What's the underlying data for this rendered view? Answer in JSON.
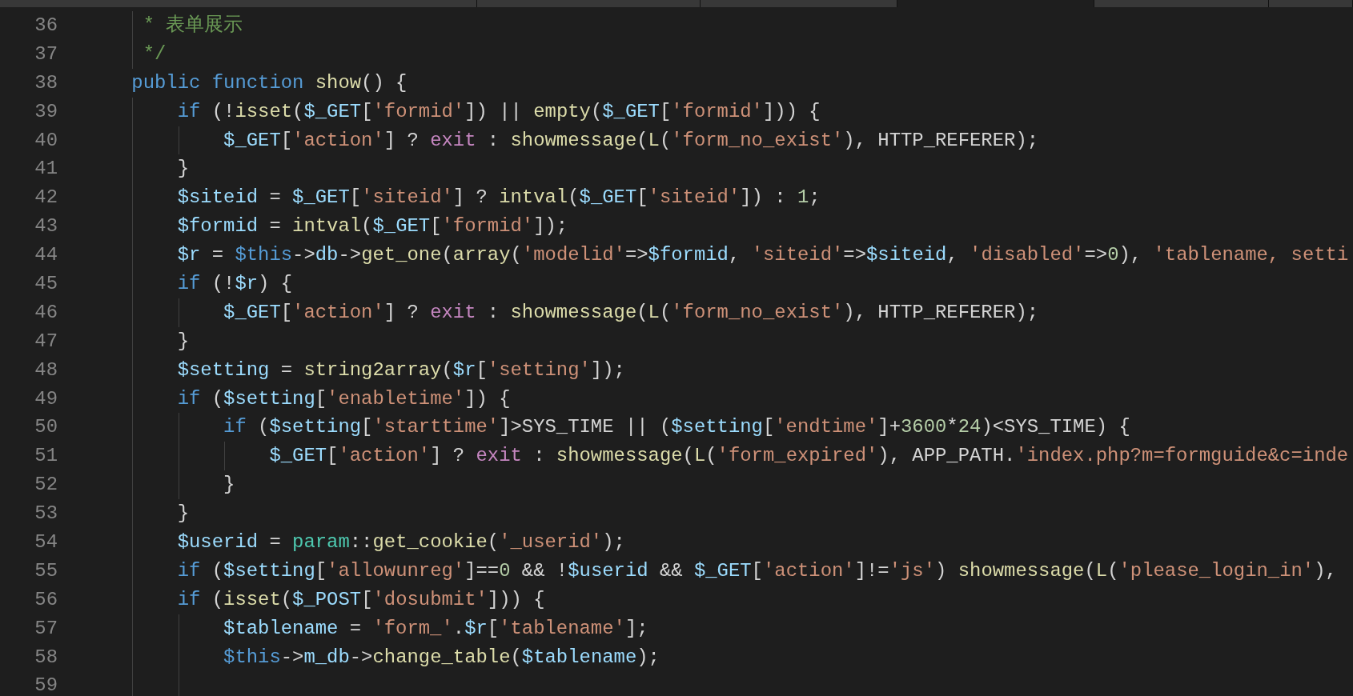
{
  "tabs": [
    {
      "selected": false
    },
    {
      "selected": false
    },
    {
      "selected": false
    },
    {
      "selected": true
    },
    {
      "selected": false
    },
    {
      "selected": false
    }
  ],
  "lines": [
    {
      "number": "36",
      "tokens": [
        {
          "kind": "comment",
          "text": "     * 表单展示"
        }
      ]
    },
    {
      "number": "37",
      "tokens": [
        {
          "kind": "comment",
          "text": "     */"
        }
      ]
    },
    {
      "number": "38",
      "tokens": [
        {
          "kind": "keyword",
          "text": "    public function "
        },
        {
          "kind": "function",
          "text": "show"
        },
        {
          "kind": "plain",
          "text": "() {"
        }
      ]
    },
    {
      "number": "39",
      "tokens": [
        {
          "kind": "keyword",
          "text": "        if "
        },
        {
          "kind": "plain",
          "text": "(!"
        },
        {
          "kind": "function",
          "text": "isset"
        },
        {
          "kind": "plain",
          "text": "("
        },
        {
          "kind": "variable",
          "text": "$_GET"
        },
        {
          "kind": "plain",
          "text": "["
        },
        {
          "kind": "string",
          "text": "'formid'"
        },
        {
          "kind": "plain",
          "text": "]) || "
        },
        {
          "kind": "function",
          "text": "empty"
        },
        {
          "kind": "plain",
          "text": "("
        },
        {
          "kind": "variable",
          "text": "$_GET"
        },
        {
          "kind": "plain",
          "text": "["
        },
        {
          "kind": "string",
          "text": "'formid'"
        },
        {
          "kind": "plain",
          "text": "])) {"
        }
      ]
    },
    {
      "number": "40",
      "tokens": [
        {
          "kind": "variable",
          "text": "            $_GET"
        },
        {
          "kind": "plain",
          "text": "["
        },
        {
          "kind": "string",
          "text": "'action'"
        },
        {
          "kind": "plain",
          "text": "] ? "
        },
        {
          "kind": "control",
          "text": "exit"
        },
        {
          "kind": "plain",
          "text": " : "
        },
        {
          "kind": "function",
          "text": "showmessage"
        },
        {
          "kind": "plain",
          "text": "("
        },
        {
          "kind": "function",
          "text": "L"
        },
        {
          "kind": "plain",
          "text": "("
        },
        {
          "kind": "string",
          "text": "'form_no_exist'"
        },
        {
          "kind": "plain",
          "text": "), HTTP_REFERER);"
        }
      ]
    },
    {
      "number": "41",
      "tokens": [
        {
          "kind": "plain",
          "text": "        }"
        }
      ]
    },
    {
      "number": "42",
      "tokens": [
        {
          "kind": "variable",
          "text": "        $siteid"
        },
        {
          "kind": "plain",
          "text": " = "
        },
        {
          "kind": "variable",
          "text": "$_GET"
        },
        {
          "kind": "plain",
          "text": "["
        },
        {
          "kind": "string",
          "text": "'siteid'"
        },
        {
          "kind": "plain",
          "text": "] ? "
        },
        {
          "kind": "function",
          "text": "intval"
        },
        {
          "kind": "plain",
          "text": "("
        },
        {
          "kind": "variable",
          "text": "$_GET"
        },
        {
          "kind": "plain",
          "text": "["
        },
        {
          "kind": "string",
          "text": "'siteid'"
        },
        {
          "kind": "plain",
          "text": "]) : "
        },
        {
          "kind": "number",
          "text": "1"
        },
        {
          "kind": "plain",
          "text": ";"
        }
      ]
    },
    {
      "number": "43",
      "tokens": [
        {
          "kind": "variable",
          "text": "        $formid"
        },
        {
          "kind": "plain",
          "text": " = "
        },
        {
          "kind": "function",
          "text": "intval"
        },
        {
          "kind": "plain",
          "text": "("
        },
        {
          "kind": "variable",
          "text": "$_GET"
        },
        {
          "kind": "plain",
          "text": "["
        },
        {
          "kind": "string",
          "text": "'formid'"
        },
        {
          "kind": "plain",
          "text": "]);"
        }
      ]
    },
    {
      "number": "44",
      "tokens": [
        {
          "kind": "variable",
          "text": "        $r"
        },
        {
          "kind": "plain",
          "text": " = "
        },
        {
          "kind": "keyword",
          "text": "$this"
        },
        {
          "kind": "plain",
          "text": "->"
        },
        {
          "kind": "variable",
          "text": "db"
        },
        {
          "kind": "plain",
          "text": "->"
        },
        {
          "kind": "function",
          "text": "get_one"
        },
        {
          "kind": "plain",
          "text": "("
        },
        {
          "kind": "function",
          "text": "array"
        },
        {
          "kind": "plain",
          "text": "("
        },
        {
          "kind": "string",
          "text": "'modelid'"
        },
        {
          "kind": "plain",
          "text": "=>"
        },
        {
          "kind": "variable",
          "text": "$formid"
        },
        {
          "kind": "plain",
          "text": ", "
        },
        {
          "kind": "string",
          "text": "'siteid'"
        },
        {
          "kind": "plain",
          "text": "=>"
        },
        {
          "kind": "variable",
          "text": "$siteid"
        },
        {
          "kind": "plain",
          "text": ", "
        },
        {
          "kind": "string",
          "text": "'disabled'"
        },
        {
          "kind": "plain",
          "text": "=>"
        },
        {
          "kind": "number",
          "text": "0"
        },
        {
          "kind": "plain",
          "text": "), "
        },
        {
          "kind": "string",
          "text": "'tablename, setti"
        }
      ]
    },
    {
      "number": "45",
      "tokens": [
        {
          "kind": "keyword",
          "text": "        if "
        },
        {
          "kind": "plain",
          "text": "(!"
        },
        {
          "kind": "variable",
          "text": "$r"
        },
        {
          "kind": "plain",
          "text": ") {"
        }
      ]
    },
    {
      "number": "46",
      "tokens": [
        {
          "kind": "variable",
          "text": "            $_GET"
        },
        {
          "kind": "plain",
          "text": "["
        },
        {
          "kind": "string",
          "text": "'action'"
        },
        {
          "kind": "plain",
          "text": "] ? "
        },
        {
          "kind": "control",
          "text": "exit"
        },
        {
          "kind": "plain",
          "text": " : "
        },
        {
          "kind": "function",
          "text": "showmessage"
        },
        {
          "kind": "plain",
          "text": "("
        },
        {
          "kind": "function",
          "text": "L"
        },
        {
          "kind": "plain",
          "text": "("
        },
        {
          "kind": "string",
          "text": "'form_no_exist'"
        },
        {
          "kind": "plain",
          "text": "), HTTP_REFERER);"
        }
      ]
    },
    {
      "number": "47",
      "tokens": [
        {
          "kind": "plain",
          "text": "        }"
        }
      ]
    },
    {
      "number": "48",
      "tokens": [
        {
          "kind": "variable",
          "text": "        $setting"
        },
        {
          "kind": "plain",
          "text": " = "
        },
        {
          "kind": "function",
          "text": "string2array"
        },
        {
          "kind": "plain",
          "text": "("
        },
        {
          "kind": "variable",
          "text": "$r"
        },
        {
          "kind": "plain",
          "text": "["
        },
        {
          "kind": "string",
          "text": "'setting'"
        },
        {
          "kind": "plain",
          "text": "]);"
        }
      ]
    },
    {
      "number": "49",
      "tokens": [
        {
          "kind": "keyword",
          "text": "        if "
        },
        {
          "kind": "plain",
          "text": "("
        },
        {
          "kind": "variable",
          "text": "$setting"
        },
        {
          "kind": "plain",
          "text": "["
        },
        {
          "kind": "string",
          "text": "'enabletime'"
        },
        {
          "kind": "plain",
          "text": "]) {"
        }
      ]
    },
    {
      "number": "50",
      "tokens": [
        {
          "kind": "keyword",
          "text": "            if "
        },
        {
          "kind": "plain",
          "text": "("
        },
        {
          "kind": "variable",
          "text": "$setting"
        },
        {
          "kind": "plain",
          "text": "["
        },
        {
          "kind": "string",
          "text": "'starttime'"
        },
        {
          "kind": "plain",
          "text": "]>SYS_TIME || ("
        },
        {
          "kind": "variable",
          "text": "$setting"
        },
        {
          "kind": "plain",
          "text": "["
        },
        {
          "kind": "string",
          "text": "'endtime'"
        },
        {
          "kind": "plain",
          "text": "]+"
        },
        {
          "kind": "number",
          "text": "3600"
        },
        {
          "kind": "plain",
          "text": "*"
        },
        {
          "kind": "number",
          "text": "24"
        },
        {
          "kind": "plain",
          "text": ")<SYS_TIME) {"
        }
      ]
    },
    {
      "number": "51",
      "tokens": [
        {
          "kind": "variable",
          "text": "                $_GET"
        },
        {
          "kind": "plain",
          "text": "["
        },
        {
          "kind": "string",
          "text": "'action'"
        },
        {
          "kind": "plain",
          "text": "] ? "
        },
        {
          "kind": "control",
          "text": "exit"
        },
        {
          "kind": "plain",
          "text": " : "
        },
        {
          "kind": "function",
          "text": "showmessage"
        },
        {
          "kind": "plain",
          "text": "("
        },
        {
          "kind": "function",
          "text": "L"
        },
        {
          "kind": "plain",
          "text": "("
        },
        {
          "kind": "string",
          "text": "'form_expired'"
        },
        {
          "kind": "plain",
          "text": "), APP_PATH."
        },
        {
          "kind": "string",
          "text": "'index.php?m=formguide&c=inde"
        }
      ]
    },
    {
      "number": "52",
      "tokens": [
        {
          "kind": "plain",
          "text": "            }"
        }
      ]
    },
    {
      "number": "53",
      "tokens": [
        {
          "kind": "plain",
          "text": "        }"
        }
      ]
    },
    {
      "number": "54",
      "tokens": [
        {
          "kind": "variable",
          "text": "        $userid"
        },
        {
          "kind": "plain",
          "text": " = "
        },
        {
          "kind": "type",
          "text": "param"
        },
        {
          "kind": "plain",
          "text": "::"
        },
        {
          "kind": "function",
          "text": "get_cookie"
        },
        {
          "kind": "plain",
          "text": "("
        },
        {
          "kind": "string",
          "text": "'_userid'"
        },
        {
          "kind": "plain",
          "text": ");"
        }
      ]
    },
    {
      "number": "55",
      "tokens": [
        {
          "kind": "keyword",
          "text": "        if "
        },
        {
          "kind": "plain",
          "text": "("
        },
        {
          "kind": "variable",
          "text": "$setting"
        },
        {
          "kind": "plain",
          "text": "["
        },
        {
          "kind": "string",
          "text": "'allowunreg'"
        },
        {
          "kind": "plain",
          "text": "]=="
        },
        {
          "kind": "number",
          "text": "0"
        },
        {
          "kind": "plain",
          "text": " && !"
        },
        {
          "kind": "variable",
          "text": "$userid"
        },
        {
          "kind": "plain",
          "text": " && "
        },
        {
          "kind": "variable",
          "text": "$_GET"
        },
        {
          "kind": "plain",
          "text": "["
        },
        {
          "kind": "string",
          "text": "'action'"
        },
        {
          "kind": "plain",
          "text": "]!="
        },
        {
          "kind": "string",
          "text": "'js'"
        },
        {
          "kind": "plain",
          "text": ") "
        },
        {
          "kind": "function",
          "text": "showmessage"
        },
        {
          "kind": "plain",
          "text": "("
        },
        {
          "kind": "function",
          "text": "L"
        },
        {
          "kind": "plain",
          "text": "("
        },
        {
          "kind": "string",
          "text": "'please_login_in'"
        },
        {
          "kind": "plain",
          "text": "),"
        }
      ]
    },
    {
      "number": "56",
      "tokens": [
        {
          "kind": "keyword",
          "text": "        if "
        },
        {
          "kind": "plain",
          "text": "("
        },
        {
          "kind": "function",
          "text": "isset"
        },
        {
          "kind": "plain",
          "text": "("
        },
        {
          "kind": "variable",
          "text": "$_POST"
        },
        {
          "kind": "plain",
          "text": "["
        },
        {
          "kind": "string",
          "text": "'dosubmit'"
        },
        {
          "kind": "plain",
          "text": "])) {"
        }
      ]
    },
    {
      "number": "57",
      "tokens": [
        {
          "kind": "variable",
          "text": "            $tablename"
        },
        {
          "kind": "plain",
          "text": " = "
        },
        {
          "kind": "string",
          "text": "'form_'"
        },
        {
          "kind": "plain",
          "text": "."
        },
        {
          "kind": "variable",
          "text": "$r"
        },
        {
          "kind": "plain",
          "text": "["
        },
        {
          "kind": "string",
          "text": "'tablename'"
        },
        {
          "kind": "plain",
          "text": "];"
        }
      ]
    },
    {
      "number": "58",
      "tokens": [
        {
          "kind": "keyword",
          "text": "            $this"
        },
        {
          "kind": "plain",
          "text": "->"
        },
        {
          "kind": "variable",
          "text": "m_db"
        },
        {
          "kind": "plain",
          "text": "->"
        },
        {
          "kind": "function",
          "text": "change_table"
        },
        {
          "kind": "plain",
          "text": "("
        },
        {
          "kind": "variable",
          "text": "$tablename"
        },
        {
          "kind": "plain",
          "text": ");"
        }
      ]
    },
    {
      "number": "59"
    }
  ]
}
